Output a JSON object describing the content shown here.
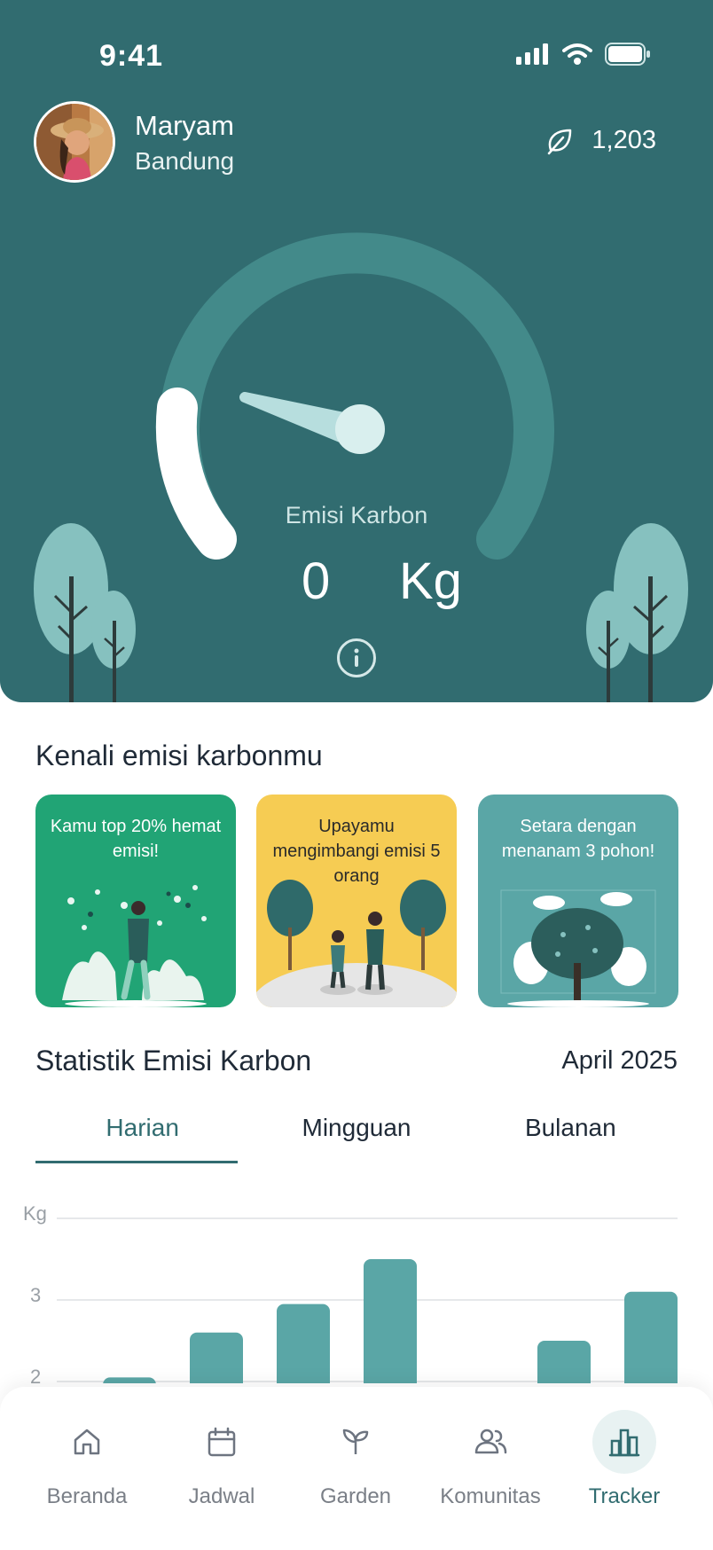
{
  "status_bar": {
    "time": "9:41"
  },
  "user": {
    "name": "Maryam",
    "city": "Bandung",
    "points": "1,203"
  },
  "gauge": {
    "label": "Emisi Karbon",
    "value": "0",
    "unit": "Kg",
    "level_fraction": 0.12
  },
  "section_know": {
    "title": "Kenali emisi karbonmu",
    "cards": [
      {
        "text": "Kamu top 20% hemat emisi!",
        "color": "#21a475"
      },
      {
        "text": "Upayamu mengimbangi emisi 5 orang",
        "color": "#f6cc53"
      },
      {
        "text": "Setara dengan menanam 3 pohon!",
        "color": "#5aa6a6"
      }
    ]
  },
  "statistics": {
    "title": "Statistik Emisi Karbon",
    "month": "April 2025",
    "tabs": [
      "Harian",
      "Mingguan",
      "Bulanan"
    ],
    "active_tab": "Harian"
  },
  "chart_data": {
    "type": "bar",
    "ylabel": "Kg",
    "y_ticks": [
      "3",
      "2"
    ],
    "values": [
      2.05,
      2.6,
      2.95,
      3.5,
      null,
      2.5,
      3.1
    ],
    "color": "#5aa6a6"
  },
  "nav": {
    "items": [
      {
        "label": "Beranda",
        "icon": "home-icon"
      },
      {
        "label": "Jadwal",
        "icon": "calendar-icon"
      },
      {
        "label": "Garden",
        "icon": "sprout-icon"
      },
      {
        "label": "Komunitas",
        "icon": "community-icon"
      },
      {
        "label": "Tracker",
        "icon": "chart-icon"
      }
    ],
    "active": "Tracker",
    "active_color": "#316c70"
  }
}
